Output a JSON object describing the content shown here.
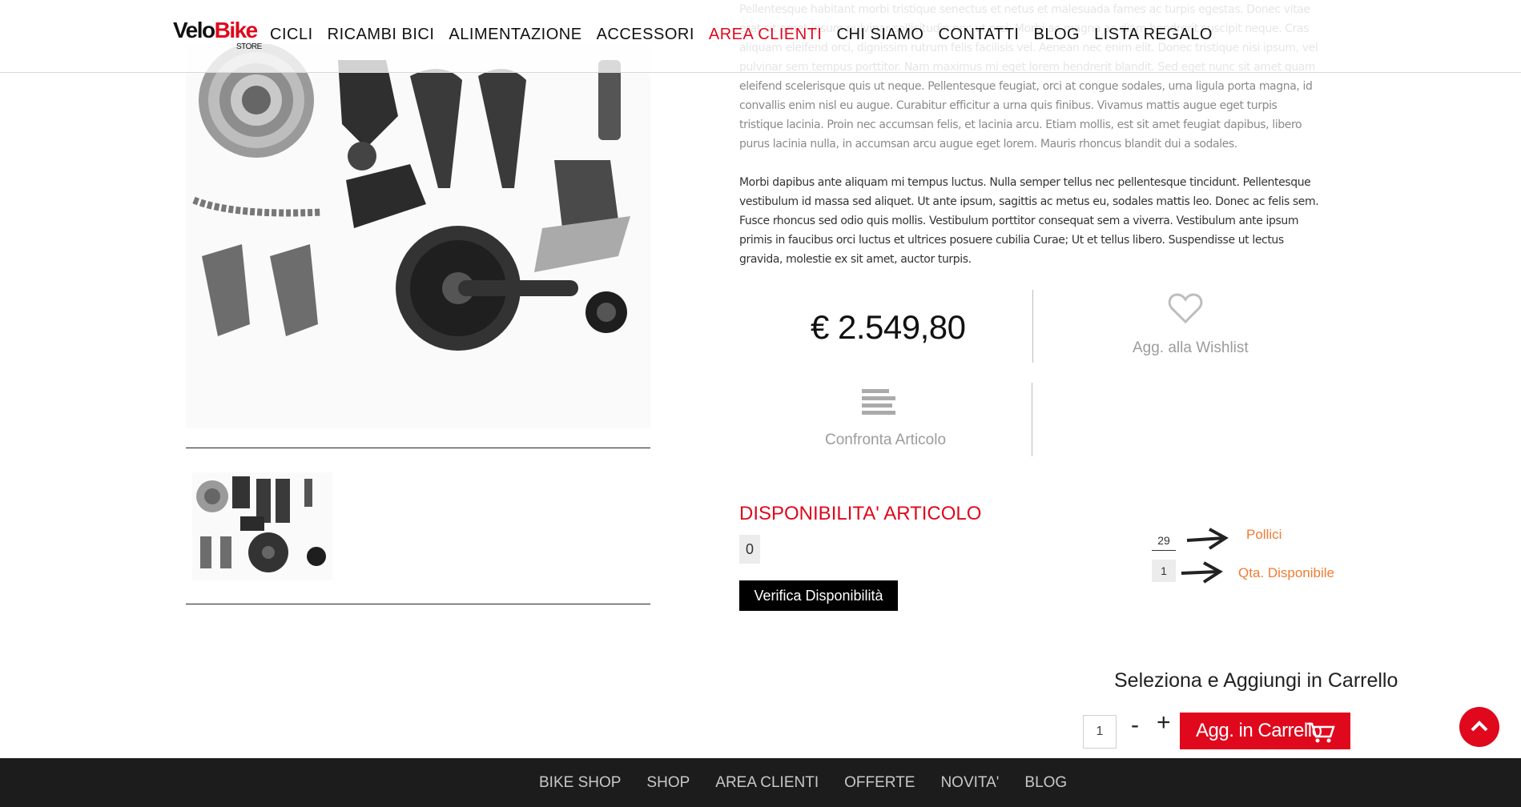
{
  "header": {
    "logo": {
      "velo": "Velo",
      "bike": "Bike",
      "store": "STORE"
    },
    "nav": [
      {
        "label": "CICLI"
      },
      {
        "label": "RICAMBI BICI"
      },
      {
        "label": "ALIMENTAZIONE"
      },
      {
        "label": "ACCESSORI"
      },
      {
        "label": "AREA CLIENTI"
      },
      {
        "label": "CHI SIAMO"
      },
      {
        "label": "CONTATTI"
      },
      {
        "label": "BLOG"
      },
      {
        "label": "LISTA REGALO"
      }
    ]
  },
  "description": {
    "para_top": "Pellentesque habitant morbi tristique senectus et netus et malesuada fames ac turpis egestas. Donec vitae erat sit amet ipsum pulvinar sollicitudin nec ut orci. Morbi ac magna ac diam hendrerit suscipit neque. Cras aliquam eleifend orci, dignissim rutrum felis facilisis vel. Aenean nec enim elit. Donec tristique nisi ipsum, vel pulvinar sem tempus porttitor. Nam maximus mi eget lorem hendrerit blandit. Sed eget nunc sit amet quam eleifend scelerisque quis ut neque. Pellentesque feugiat, orci at congue sodales, urna ligula porta magna, id convallis enim nisl eu augue. Curabitur efficitur a urna quis finibus. Vivamus mattis augue eget turpis tristique lacinia. Proin nec accumsan felis, et lacinia arcu. Etiam mollis, est sit amet feugiat dapibus, libero purus lacinia nulla, in accumsan arcu augue eget lorem. Mauris rhoncus blandit dui a sodales.",
    "para_bottom": "Morbi dapibus ante aliquam mi tempus luctus. Nulla semper tellus nec pellentesque tincidunt. Pellentesque vestibulum id massa sed aliquet. Ut ante ipsum, sagittis ac metus eu, sodales mattis leo. Donec ac felis sem. Fusce rhoncus sed odio quis mollis. Vestibulum porttitor consequat sem a viverra. Vestibulum ante ipsum primis in faucibus orci luctus et ultrices posuere cubilia Curae; Ut et tellus libero. Suspendisse ut lectus gravida, molestie ex sit amet, auctor turpis."
  },
  "product": {
    "price": "€ 2.549,80",
    "wishlist_label": "Agg. alla Wishlist",
    "compare_label": "Confronta Articolo",
    "icons": {
      "wishlist": "heart-icon",
      "compare": "compare-lines-icon"
    }
  },
  "availability": {
    "title": "DISPONIBILITA' ARTICOLO",
    "value": "0",
    "verify_label": "Verifica Disponibilità",
    "size_value": "29",
    "size_label": "Pollici",
    "qty_value": "1",
    "qty_label": "Qta. Disponibile"
  },
  "cart": {
    "title": "Seleziona e Aggiungi in Carrello",
    "quantity": "1",
    "minus": "-",
    "plus": "+",
    "add_label": "Agg. in Carrello"
  },
  "footer": {
    "nav": [
      {
        "label": "BIKE SHOP"
      },
      {
        "label": "SHOP"
      },
      {
        "label": "AREA CLIENTI"
      },
      {
        "label": "OFFERTE"
      },
      {
        "label": "NOVITA'"
      },
      {
        "label": "BLOG"
      }
    ]
  },
  "colors": {
    "accent": "#e0081c",
    "orange": "#f07c33",
    "footer_bg": "#1c1c1c"
  }
}
